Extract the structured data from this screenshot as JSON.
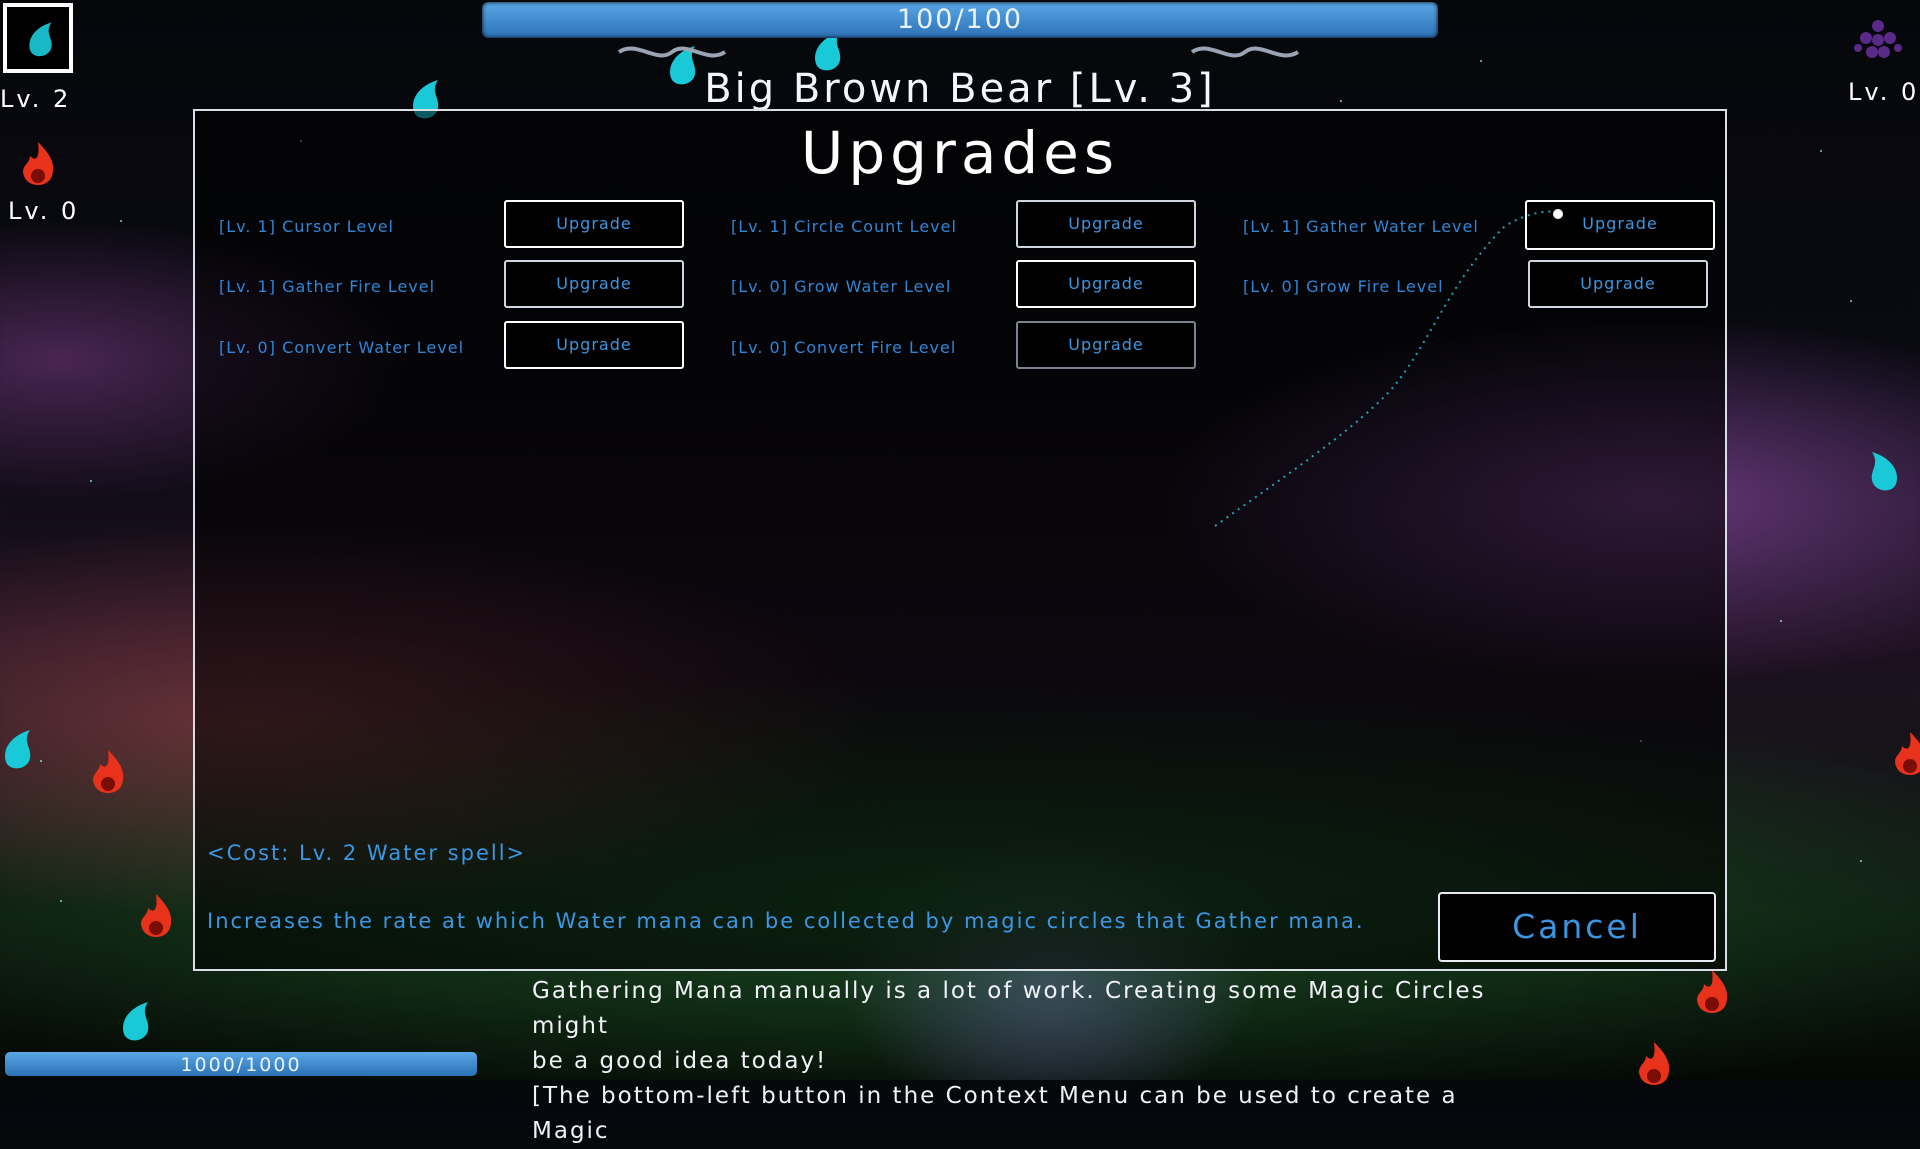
{
  "hud": {
    "enemy_hp": "100/100",
    "enemy_name": "Big Brown Bear [Lv. 3]",
    "water_level": "Lv. 2",
    "fire_level": "Lv. 0",
    "dark_level": "Lv. 0",
    "player_mana": "1000/1000"
  },
  "modal": {
    "title": "Upgrades",
    "upgrades": [
      {
        "label": "[Lv. 1] Cursor Level",
        "button": "Upgrade"
      },
      {
        "label": "[Lv. 1] Circle Count Level",
        "button": "Upgrade"
      },
      {
        "label": "[Lv. 1] Gather Water Level",
        "button": "Upgrade"
      },
      {
        "label": "[Lv. 1] Gather Fire Level",
        "button": "Upgrade"
      },
      {
        "label": "[Lv. 0] Grow Water Level",
        "button": "Upgrade"
      },
      {
        "label": "[Lv. 0] Grow Fire Level",
        "button": "Upgrade"
      },
      {
        "label": "[Lv. 0] Convert Water Level",
        "button": "Upgrade"
      },
      {
        "label": "[Lv. 0] Convert Fire Level",
        "button": "Upgrade"
      }
    ],
    "cost": "<Cost: Lv. 2 Water spell>",
    "description": "Increases the rate at which Water mana can be collected by magic circles that Gather mana.",
    "cancel": "Cancel"
  },
  "dialogue": {
    "line1": "Gathering Mana manually is a lot of work. Creating some Magic Circles might",
    "line2": "be a good idea today!",
    "line3": "[The bottom-left button in the Context Menu can be used to create a Magic"
  },
  "colors": {
    "accent_text": "#3c95e0",
    "hp_bar": "#4a95d8",
    "water_drop": "#19c9d8",
    "fire": "#e8321c"
  }
}
